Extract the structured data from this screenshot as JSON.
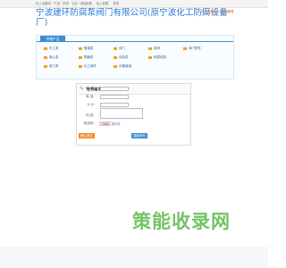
{
  "topbar": {
    "crumbs": "化工设备网 · 产品 · 供求 · 企业 · 展会",
    "links": [
      "收藏",
      "加入收藏",
      "登录"
    ]
  },
  "header": {
    "title": "宁波建环防腐泵阀门有限公司(原宁波化工防腐设备厂)",
    "right_links": [
      "化工设备网",
      "会员管理"
    ]
  },
  "products": {
    "tab": "供销产品",
    "items": [
      "化工泵",
      "管道泵",
      "阀门",
      "泵阀",
      "阀门配件",
      "离心泵",
      "隔膜泵",
      "自吸泵",
      "耐腐蚀泵",
      "磁力泵",
      "化工管件",
      "衬氟管道"
    ]
  },
  "message": {
    "title": "在线留言",
    "subtitle": "Online Messages",
    "labels": {
      "name": "姓 名：",
      "phone": "电 话：",
      "qq": "Q Q：",
      "content": "内 容：",
      "code": "验证码："
    },
    "captcha": "7582",
    "refresh": "看不清",
    "submit": "确认提交",
    "reset": "重新填写"
  },
  "watermark": "策能收录网"
}
